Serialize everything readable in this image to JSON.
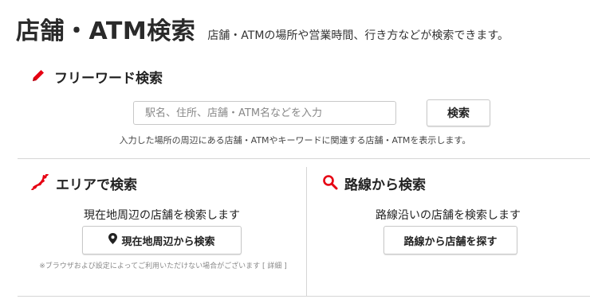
{
  "header": {
    "title": "店舗・ATM検索",
    "subtitle": "店舗・ATMの場所や営業時間、行き方などが検索できます。"
  },
  "free_word": {
    "heading": "フリーワード検索",
    "placeholder": "駅名、住所、店舗・ATM名などを入力",
    "value": "",
    "button_label": "検索",
    "description": "入力した場所の周辺にある店舗・ATMやキーワードに関連する店舗・ATMを表示します。"
  },
  "area": {
    "heading": "エリアで検索",
    "description": "現在地周辺の店舗を検索します",
    "button_label": "現在地周辺から検索",
    "note_text": "※ブラウザおよび設定によってご利用いただけない場合がございます",
    "note_link": "[ 詳細 ]"
  },
  "route": {
    "heading": "路線から検索",
    "description": "路線沿いの店舗を検索します",
    "button_label": "路線から店舗を探す"
  },
  "colors": {
    "accent": "#e60012",
    "text": "#222222",
    "border": "#c8c8c8",
    "divider": "#d6d6d6"
  },
  "icons": {
    "free_word": "pencil-icon",
    "area": "japan-map-icon",
    "route": "search-icon",
    "location": "map-pin-icon"
  }
}
